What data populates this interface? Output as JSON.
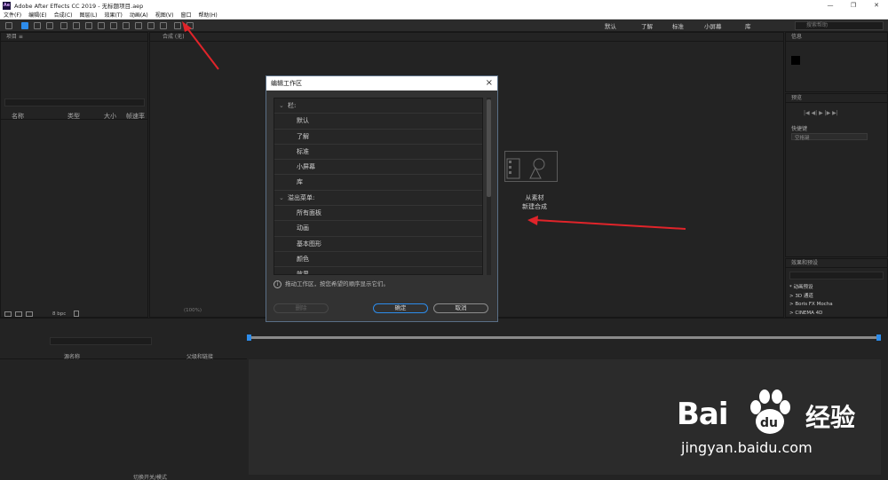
{
  "window": {
    "app_icon": "Ae",
    "title": "Adobe After Effects CC 2019 - 无标题项目.aep",
    "controls": [
      "—",
      "❐",
      "✕"
    ]
  },
  "menu": [
    "文件(F)",
    "编辑(E)",
    "合成(C)",
    "图层(L)",
    "效果(T)",
    "动画(A)",
    "视图(V)",
    "窗口",
    "帮助(H)"
  ],
  "workspaces": [
    "默认",
    "了解",
    "标准",
    "小屏幕",
    "库"
  ],
  "workspace_search": "搜索帮助",
  "project_panel": {
    "title": "项目 ≡",
    "columns": [
      "名称",
      "类型",
      "大小",
      "帧速率"
    ],
    "bpc": "8 bpc"
  },
  "comp_panel": {
    "tab": "合成 (无)",
    "placeholder_line1": "从素材",
    "placeholder_line2": "新建合成",
    "zoom": "(100%)"
  },
  "info_panel": {
    "title": "信息"
  },
  "preview_panel": {
    "title": "预览",
    "shortcut_label": "快捷键",
    "shortcut_value": "空格键"
  },
  "effects_panel": {
    "title": "效果和预设",
    "items": [
      "* 动画预设",
      "> 3D 通道",
      "> Boris FX Mocha",
      "> CINEMA 4D"
    ]
  },
  "timeline": {
    "columns": [
      "源名称",
      "父级和链接"
    ],
    "footer": "切换开关/模式"
  },
  "dialog": {
    "title": "编辑工作区",
    "groups": [
      {
        "label": "栏:",
        "items": [
          "默认",
          "了解",
          "标准",
          "小屏幕",
          "库"
        ]
      },
      {
        "label": "溢出菜单:",
        "items": [
          "所有面板",
          "动画",
          "基本图形",
          "颜色",
          "效果"
        ]
      }
    ],
    "info": "拖动工作区，按您希望的顺序显示它们。",
    "cancel_action": "删除",
    "ok": "确定",
    "cancel": "取消"
  },
  "watermark": {
    "brand": "Bai",
    "brand2": "du",
    "jingyan": "经验",
    "url": "jingyan.baidu.com"
  },
  "colors": {
    "accent_blue": "#2d8ceb",
    "arrow_red": "#e0242a",
    "dialog_border": "#5a6f86"
  }
}
